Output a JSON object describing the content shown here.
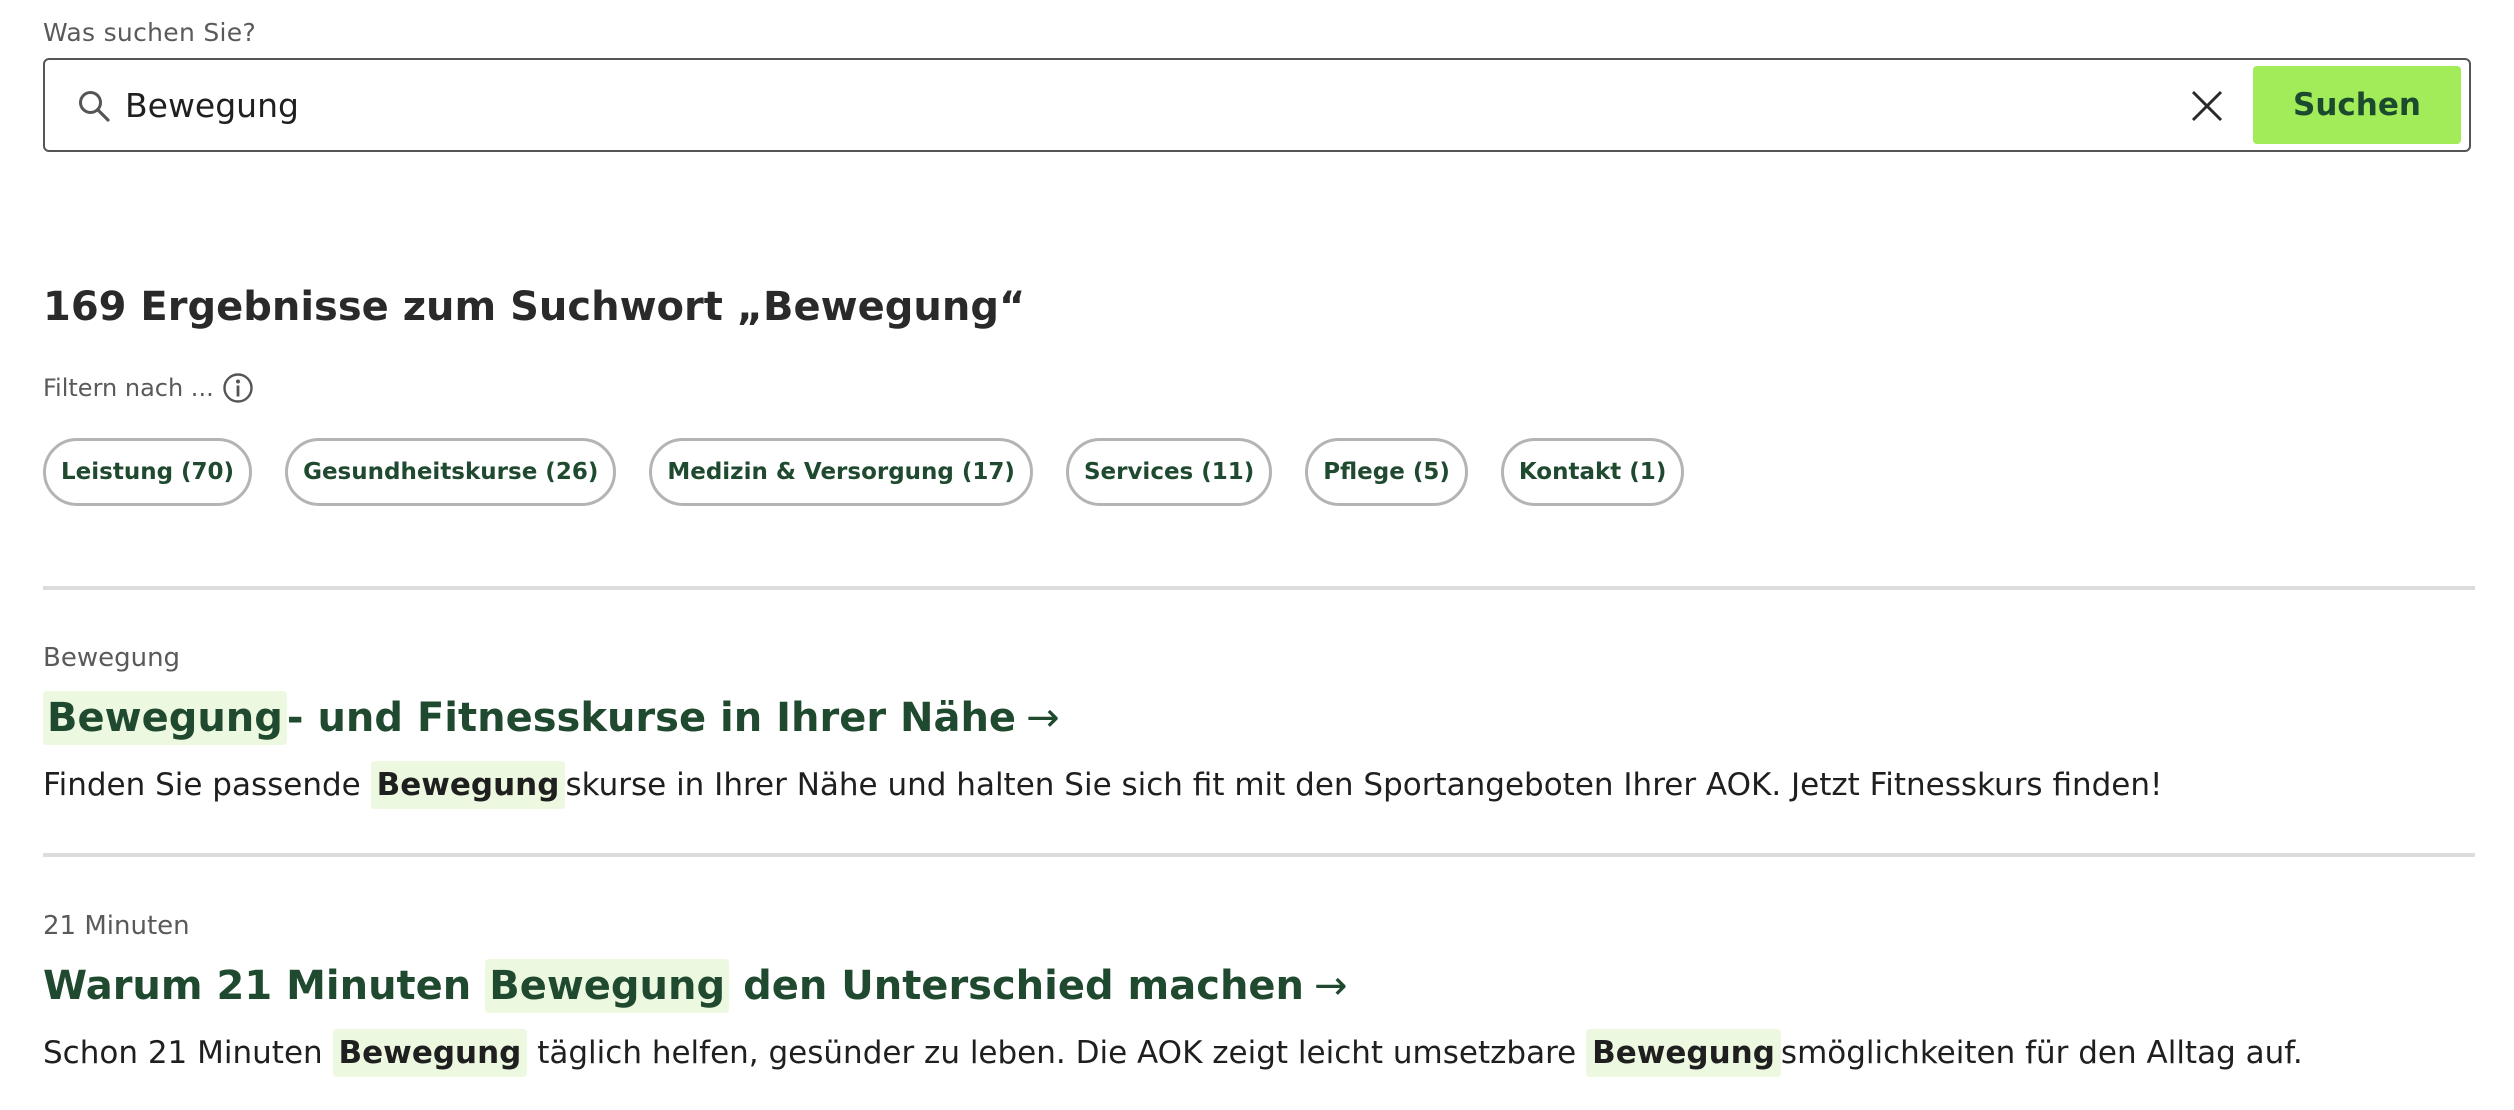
{
  "search": {
    "label": "Was suchen Sie?",
    "value": "Bewegung",
    "submit_label": "Suchen"
  },
  "results": {
    "heading": "169 Ergebnisse zum Suchwort „Bewegung“",
    "filter_label": "Filtern nach ...",
    "filters": [
      {
        "label": "Leistung (70)"
      },
      {
        "label": "Gesundheitskurse (26)"
      },
      {
        "label": "Medizin & Versorgung (17)"
      },
      {
        "label": "Services (11)"
      },
      {
        "label": "Pflege (5)"
      },
      {
        "label": "Kontakt (1)"
      }
    ],
    "items": [
      {
        "category": "Bewegung",
        "title_highlight": "Bewegung",
        "title_rest": "- und Fitnesskurse in Ihrer Nähe",
        "desc_before": "Finden Sie passende ",
        "desc_highlight": "Bewegung",
        "desc_after": "skurse in Ihrer Nähe und halten Sie sich fit mit den Sportangeboten Ihrer AOK. Jetzt Fitnesskurs finden!"
      },
      {
        "category": "21 Minuten",
        "title_before": "Warum 21 Minuten ",
        "title_highlight": "Bewegung",
        "title_after": " den Unterschied machen",
        "desc_before": "Schon 21 Minuten ",
        "desc_highlight_1": "Bewegung",
        "desc_middle": " täglich helfen, gesünder zu leben. Die AOK zeigt leicht umsetzbare ",
        "desc_highlight_2": "Bewegung",
        "desc_after": "smöglichkeiten für den Alltag auf."
      }
    ]
  },
  "icons": {
    "search": "search-icon",
    "clear": "close-icon",
    "info": "info-icon",
    "arrow": "arrow-right-icon",
    "arrow_glyph": "→"
  },
  "colors": {
    "accent": "#a1ec58",
    "brand_text": "#1f4a2f",
    "highlight_bg": "#ecf8df"
  }
}
